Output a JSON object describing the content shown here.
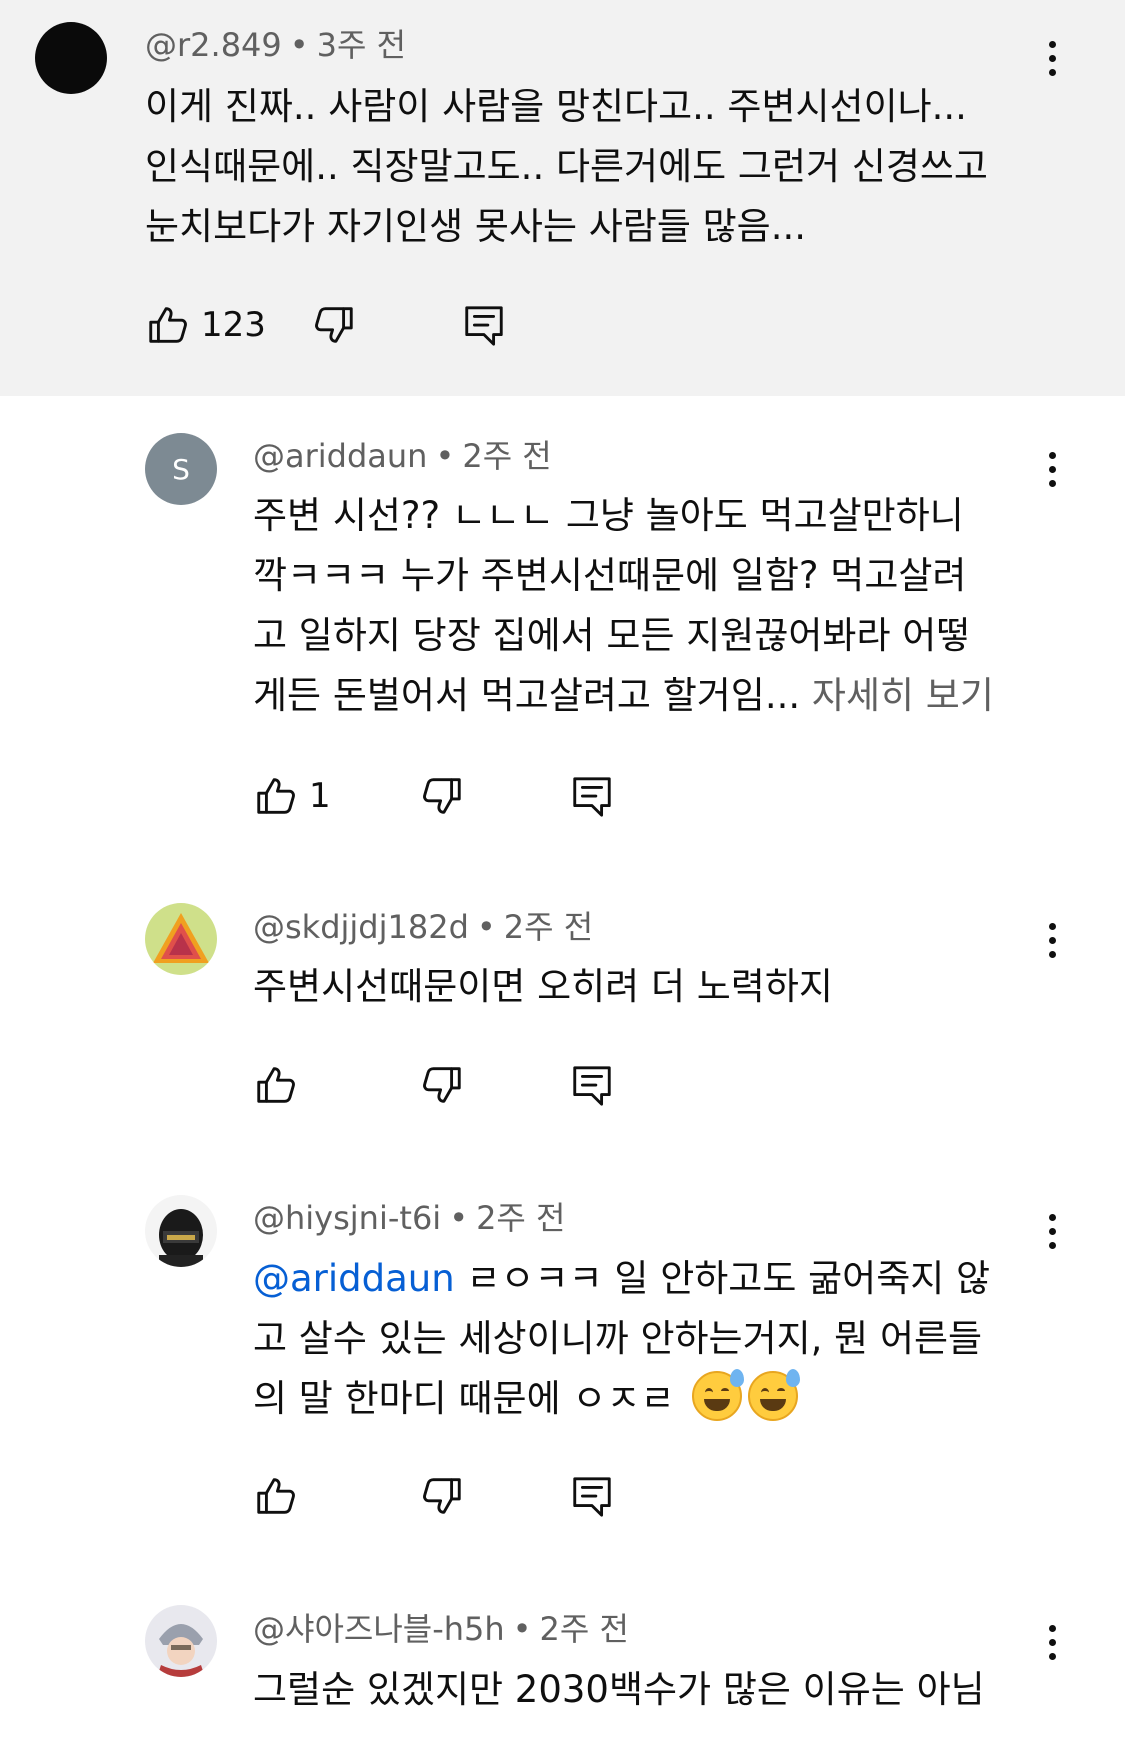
{
  "comments": [
    {
      "handle": "@r2.849",
      "time": "3주 전",
      "lines": [
        "이게 진짜.. 사람이 사람을 망친다고.. 주변시선이나...",
        "인식때문에.. 직장말고도.. 다른거에도 그런거 신경쓰고",
        "눈치보다가 자기인생 못사는 사람들 많음..."
      ],
      "likes": "123"
    },
    {
      "handle": "@ariddaun",
      "time": "2주 전",
      "avatar_letter": "S",
      "lines": [
        "주변 시선?? ㄴㄴㄴ 그냥 놀아도 먹고살만하니",
        "깍ㅋㅋㅋ 누가 주변시선때문에 일함? 먹고살려",
        "고 일하지 당장 집에서 모든 지원끊어봐라 어떻",
        "게든 돈벌어서 먹고살려고 할거임..."
      ],
      "more": "자세히 보기",
      "likes": "1"
    },
    {
      "handle": "@skdjjdj182d",
      "time": "2주 전",
      "lines": [
        "주변시선때문이면 오히려 더 노력하지"
      ]
    },
    {
      "handle": "@hiysjni-t6i",
      "time": "2주 전",
      "mention": "@ariddaun",
      "lines": [
        " ㄹㅇㅋㅋ  일 안하고도 굶어죽지 않",
        "고 살수 있는 세상이니까 안하는거지, 뭔 어른들",
        "의 말 한마디 때문에 ㅇㅈㄹ"
      ]
    },
    {
      "handle": "@샤아즈나블-h5h",
      "time": "2주 전",
      "lines": [
        "그럴순 있겠지만 2030백수가 많은 이유는 아님"
      ]
    }
  ],
  "separator": "•",
  "icons": {
    "like": "thumbs-up-icon",
    "dislike": "thumbs-down-icon",
    "reply": "reply-comment-icon",
    "more": "kebab-menu-icon"
  },
  "colors": {
    "parent_background": "#f2f2f2",
    "mention": "#065fd4",
    "meta_text": "#606060"
  }
}
